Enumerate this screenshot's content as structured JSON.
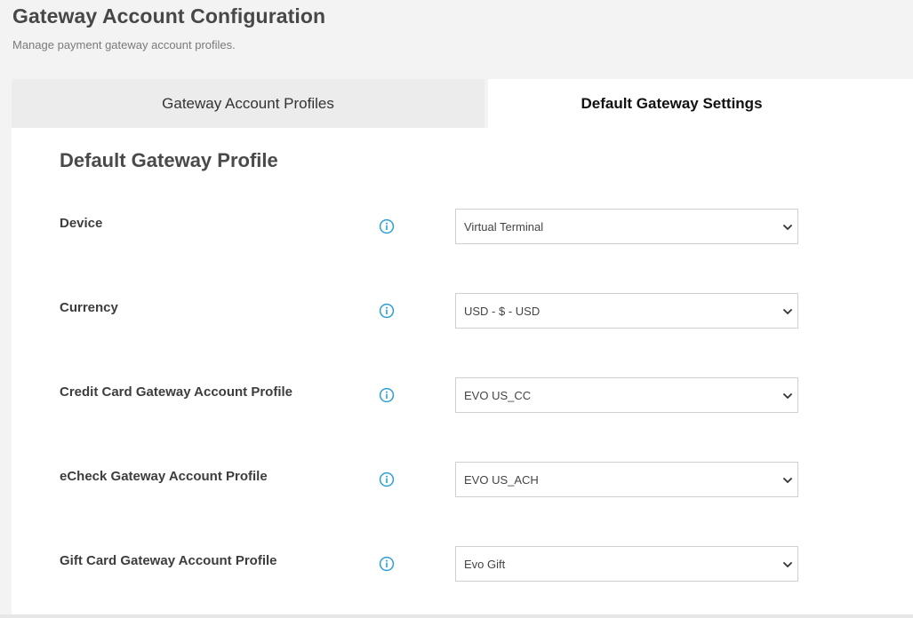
{
  "header": {
    "title": "Gateway Account Configuration",
    "subtitle": "Manage payment gateway account profiles."
  },
  "tabs": [
    {
      "label": "Gateway Account Profiles",
      "active": false
    },
    {
      "label": "Default Gateway Settings",
      "active": true
    }
  ],
  "section": {
    "title": "Default Gateway Profile"
  },
  "fields": [
    {
      "label": "Device",
      "value": "Virtual Terminal",
      "icon": "info-icon"
    },
    {
      "label": "Currency",
      "value": "USD - $ - USD",
      "icon": "info-icon"
    },
    {
      "label": "Credit Card Gateway Account Profile",
      "value": "EVO US_CC",
      "icon": "info-icon"
    },
    {
      "label": "eCheck Gateway Account Profile",
      "value": "EVO US_ACH",
      "icon": "info-icon"
    },
    {
      "label": "Gift Card Gateway Account Profile",
      "value": "Evo Gift",
      "icon": "info-icon"
    }
  ],
  "colors": {
    "page_background": "#f3f3f3",
    "panel_background": "#ffffff",
    "inactive_tab": "#ececec",
    "info_icon": "#2a9fd6",
    "select_border": "#cfcfcf"
  }
}
